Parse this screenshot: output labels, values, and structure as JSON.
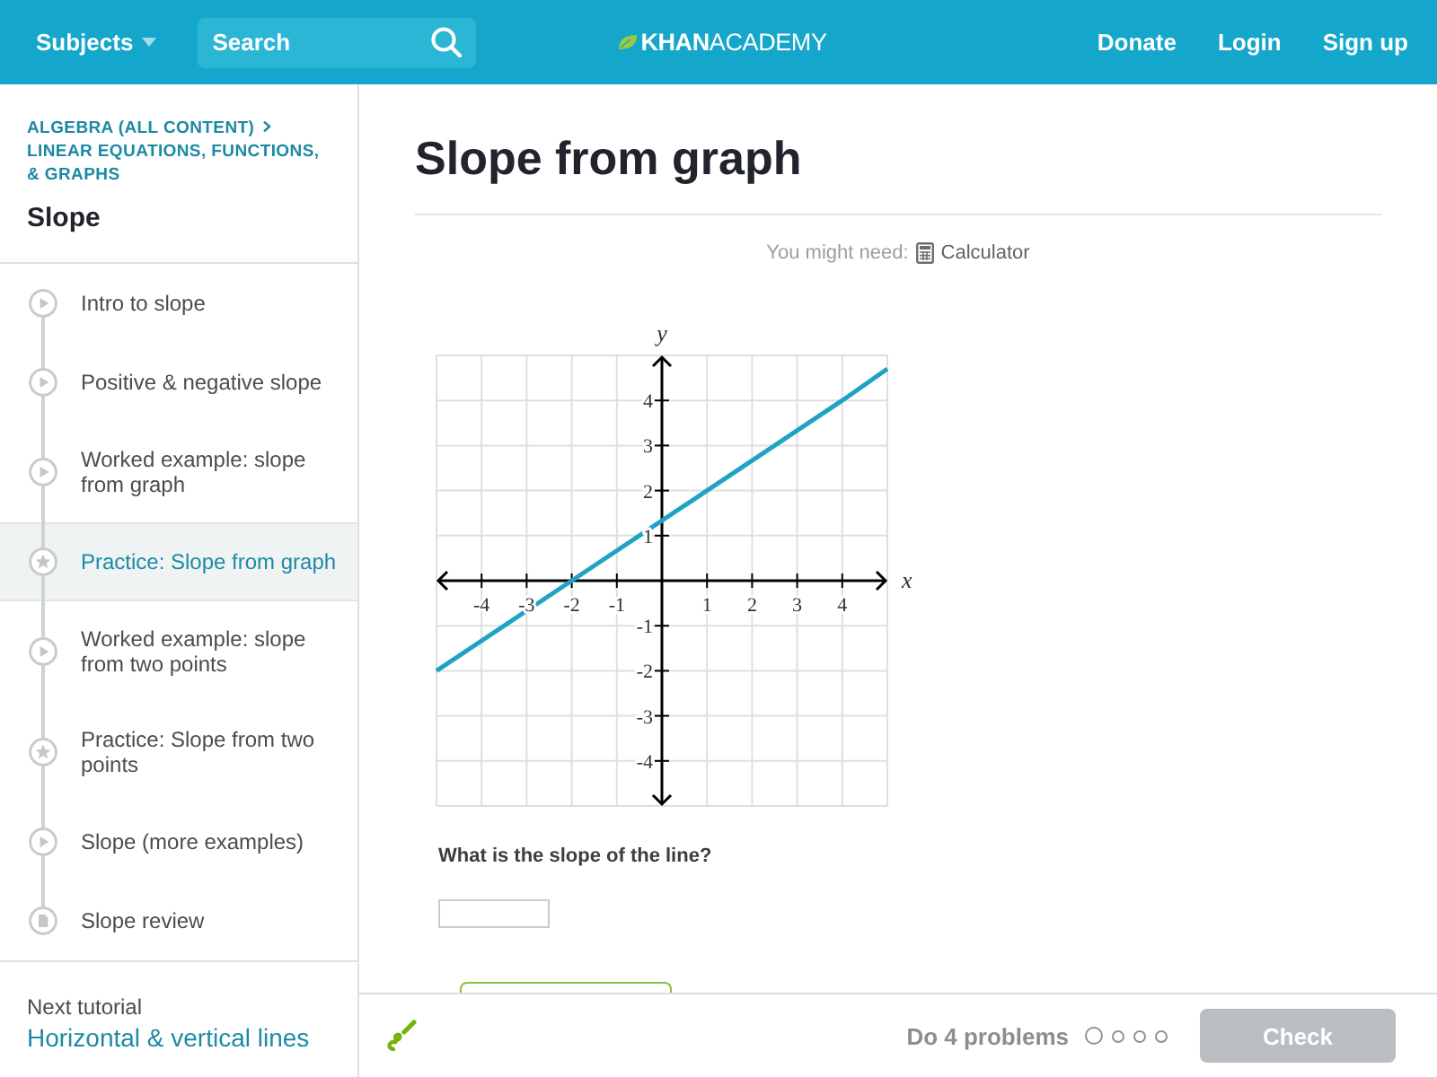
{
  "top_bar": {
    "subjects_menu": "Subjects",
    "search": {
      "placeholder": "Search"
    },
    "logo": "**KHAN**ACADEMY",
    "nav_links": [
      "Donate",
      "Login",
      "Sign up"
    ]
  },
  "sidebar": {
    "breadcrumb": [
      "ALGEBRA (ALL CONTENT)",
      "LINEAR EQUATIONS, FUNCTIONS, & GRAPHS"
    ],
    "title": "Slope",
    "items": [
      {
        "label": "Intro to slope",
        "kind": "video",
        "selected": false
      },
      {
        "label": "Positive & negative slope",
        "kind": "video",
        "selected": false
      },
      {
        "label": "Worked example: slope from graph",
        "kind": "video",
        "selected": false
      },
      {
        "label": "Practice: Slope from graph",
        "kind": "practice",
        "selected": true
      },
      {
        "label": "Worked example: slope from two points",
        "kind": "video",
        "selected": false
      },
      {
        "label": "Practice: Slope from two points",
        "kind": "practice",
        "selected": false
      },
      {
        "label": "Slope (more examples)",
        "kind": "video",
        "selected": false
      },
      {
        "label": "Slope review",
        "kind": "article",
        "selected": false
      }
    ],
    "next_tutorial": {
      "label": "Next tutorial",
      "link": "Horizontal & vertical lines"
    }
  },
  "exercise": {
    "title": "Slope from graph",
    "tools_prompt": "You might need:",
    "tool": "Calculator",
    "chart_data": {
      "type": "line",
      "xlabel": "x",
      "ylabel": "y",
      "x": [
        -5,
        -2,
        1,
        4,
        5
      ],
      "series": [
        {
          "color": "#1fa3c4",
          "values": [
            -2,
            0,
            2,
            4,
            4.7
          ]
        }
      ],
      "xlim": [
        -5,
        5
      ],
      "ylim": [
        -5,
        5
      ],
      "xticks": [
        -4,
        -3,
        -2,
        -1,
        1,
        2,
        3,
        4
      ],
      "yticks": [
        -4,
        -3,
        -2,
        -1,
        1,
        2,
        3,
        4
      ],
      "grid": true
    },
    "question": "What is the slope of the line?"
  },
  "footer": {
    "progress_label": "Do 4 problems",
    "progress_dots": [
      {
        "selected": true
      },
      {
        "selected": false
      },
      {
        "selected": false
      },
      {
        "selected": false
      }
    ],
    "check_button": {
      "label": "Check",
      "disabled": true
    }
  }
}
